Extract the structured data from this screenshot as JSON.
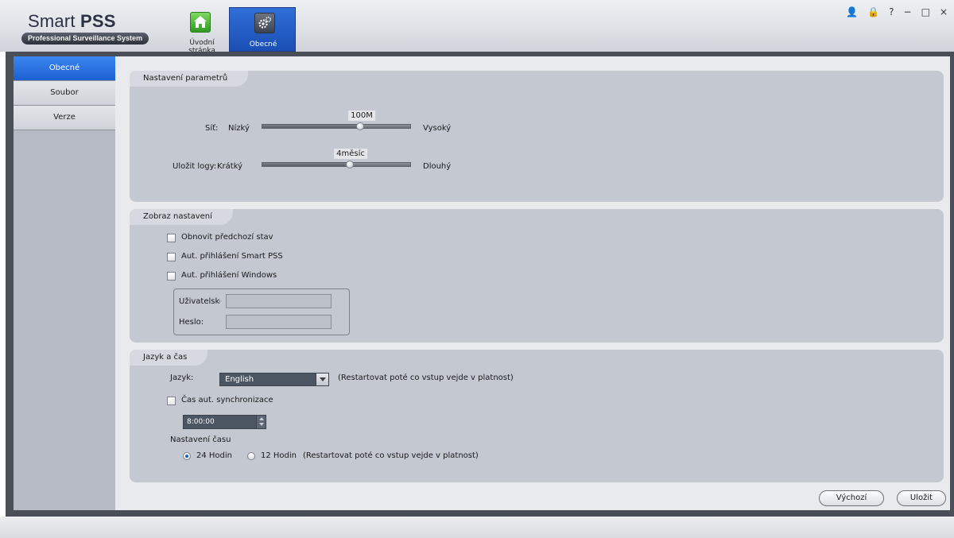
{
  "app": {
    "title_plain": "Smart ",
    "title_bold": "PSS",
    "subtitle": "Professional Surveillance System"
  },
  "nav": {
    "home_label": "Úvodní stránka",
    "general_label": "Obecné"
  },
  "window_controls": {
    "user": "👤",
    "lock": "🔒",
    "help": "?",
    "minimize": "−",
    "maximize": "□",
    "close": "×"
  },
  "sidebar": {
    "items": [
      {
        "label": "Obecné",
        "active": true
      },
      {
        "label": "Soubor",
        "active": false
      },
      {
        "label": "Verze",
        "active": false
      }
    ]
  },
  "params": {
    "title": "Nastavení parametrů",
    "network": {
      "label": "Síť:",
      "min_label": "Nízký",
      "max_label": "Vysoký",
      "value_label": "100M",
      "level": 0.66
    },
    "logs": {
      "label": "Uložit logy:",
      "min_label": "Krátký",
      "max_label": "Dlouhý",
      "value_label": "4měsíc",
      "level": 0.59
    }
  },
  "display": {
    "title": "Zobraz nastavení",
    "checkboxes": [
      {
        "label": "Obnovit předchozí stav",
        "checked": false
      },
      {
        "label": "Aut. přihlášení Smart PSS",
        "checked": false
      },
      {
        "label": "Aut. přihlášení Windows",
        "checked": false
      }
    ],
    "username_label": "Uživatelské",
    "password_label": "Heslo:"
  },
  "lang_time": {
    "title": "Jazyk a čas",
    "language_label": "Jazyk:",
    "language_value": "English",
    "language_note": "(Restartovat poté co vstup vejde v platnost)",
    "sync_label": "Čas aut. synchronizace",
    "sync_checked": false,
    "sync_time": "8:00:00",
    "time_setting_label": "Nastavení času",
    "radio_24": "24 Hodin",
    "radio_12": "12 Hodin",
    "time_note": "(Restartovat poté co vstup vejde v platnost)",
    "selected_format": "24"
  },
  "buttons": {
    "default": "Výchozí",
    "save": "Uložit"
  }
}
